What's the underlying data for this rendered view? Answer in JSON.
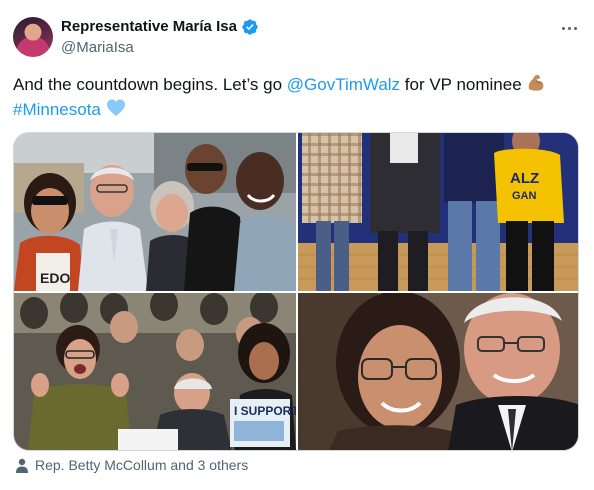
{
  "author": {
    "display_name": "Representative María Isa",
    "handle": "@MariaIsa",
    "verified": true
  },
  "tweet": {
    "text_part1": "And the countdown begins. Let’s go ",
    "mention": "@GovTimWalz",
    "text_part2": " for VP nominee ",
    "hashtag": "#Minnesota",
    "emoji_1": "flexed-biceps-emoji",
    "emoji_2": "light-blue-heart-emoji"
  },
  "media": {
    "count": 4,
    "photo_1": {
      "sign_text": "EDO"
    },
    "photo_2": {
      "shirt_text": "ALZ",
      "shirt_text_2": "GAN"
    },
    "photo_3": {
      "sign_text": "I SUPPORT"
    },
    "photo_4": {}
  },
  "tagged": {
    "text": "Rep. Betty McCollum and 3 others"
  },
  "icons": [
    "verified-badge-icon",
    "more-options-icon",
    "person-icon"
  ],
  "colors": {
    "link": "#1d9bf0",
    "secondary_text": "#536471",
    "primary_text": "#0f1419",
    "border": "#cfd9de"
  }
}
